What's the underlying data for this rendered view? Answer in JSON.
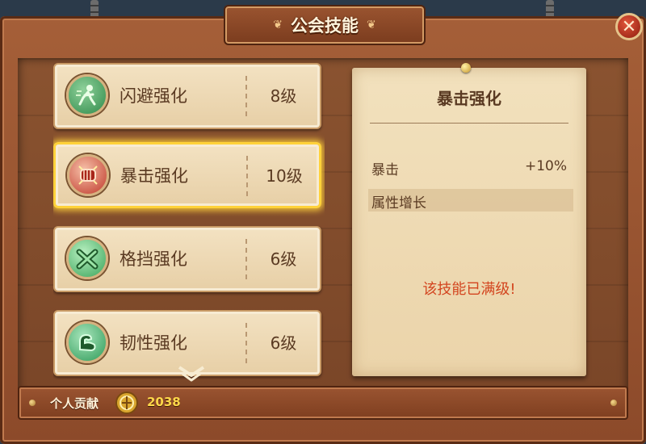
{
  "header": {
    "title": "公会技能",
    "close_icon": "close-icon"
  },
  "skills": [
    {
      "name": "闪避强化",
      "level": "8级",
      "icon": "dodge-icon",
      "icon_color": "#2f8a4a",
      "selected": false
    },
    {
      "name": "暴击强化",
      "level": "10级",
      "icon": "fist-icon",
      "icon_color": "#c0392b",
      "selected": true
    },
    {
      "name": "格挡强化",
      "level": "6级",
      "icon": "crossed-arms-icon",
      "icon_color": "#3aa35a",
      "selected": false
    },
    {
      "name": "韧性强化",
      "level": "6级",
      "icon": "muscle-arm-icon",
      "icon_color": "#2e9a58",
      "selected": false
    }
  ],
  "detail": {
    "title": "暴击强化",
    "stat_label": "暴击",
    "stat_value": "+10%",
    "growth_label": "属性增长",
    "maxed_message": "该技能已满级!"
  },
  "footer": {
    "contribution_label": "个人贡献",
    "contribution_value": "2038",
    "coin_icon": "guild-coin-icon"
  },
  "colors": {
    "selected_glow": "#ffd23a",
    "maxed_text": "#d3451f",
    "contribution_value": "#ffd84a"
  }
}
